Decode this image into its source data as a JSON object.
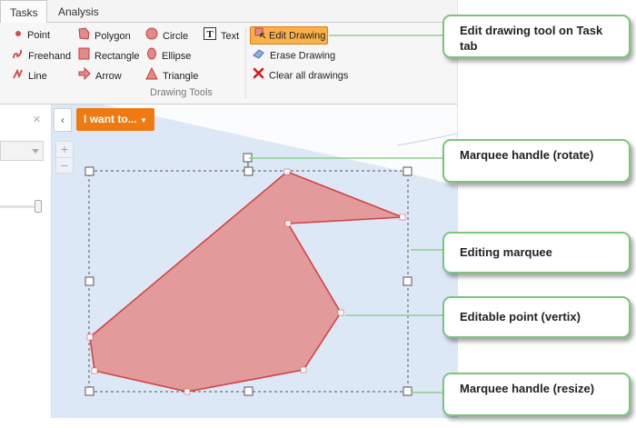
{
  "tabs": [
    {
      "label": "Tasks"
    },
    {
      "label": "Analysis"
    }
  ],
  "drawing_tools": {
    "point": "Point",
    "freehand": "Freehand",
    "line": "Line",
    "polygon": "Polygon",
    "rectangle": "Rectangle",
    "arrow": "Arrow",
    "circle": "Circle",
    "ellipse": "Ellipse",
    "triangle": "Triangle",
    "text": "Text",
    "edit_drawing": "Edit Drawing",
    "erase_drawing": "Erase Drawing",
    "clear_all": "Clear all drawings",
    "group_label": "Drawing Tools"
  },
  "left_panel": {
    "close_glyph": "×"
  },
  "map": {
    "i_want_to": "I want to...",
    "collapse_glyph": "‹",
    "zoom_in": "+",
    "zoom_out": "−"
  },
  "callouts": [
    {
      "text": "Edit drawing tool on Task tab"
    },
    {
      "text": "Marquee handle (rotate)"
    },
    {
      "text": "Editing marquee"
    },
    {
      "text": "Editable point (vertix)"
    },
    {
      "text": "Marquee handle (resize)"
    }
  ],
  "colors": {
    "accent_orange": "#ef7a12",
    "edit_button": "#fbb14a",
    "polygon_fill": "#e39a9a",
    "polygon_stroke": "#d04545",
    "callout_border": "#7cc47c",
    "map_background": "#dde8f7"
  }
}
